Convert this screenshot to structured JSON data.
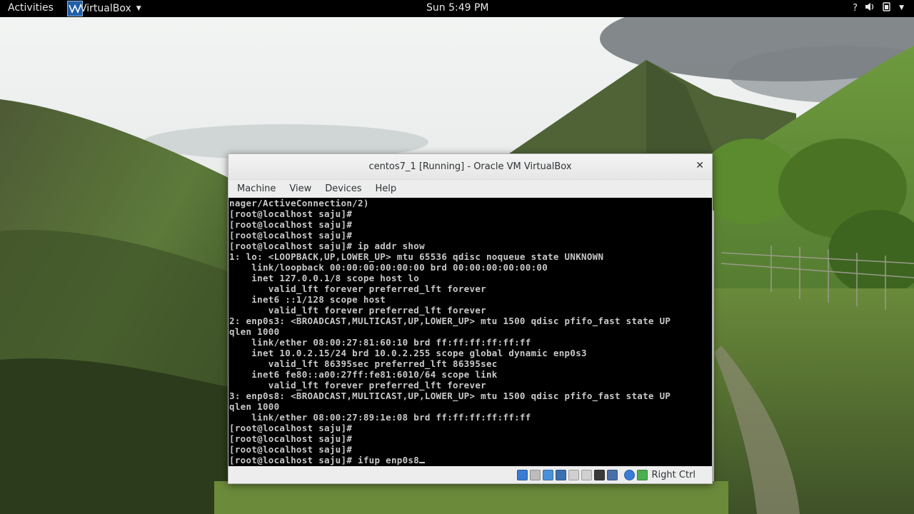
{
  "topbar": {
    "activities": "Activities",
    "app_name": "VirtualBox",
    "clock": "Sun  5:49 PM",
    "tray_help": "?"
  },
  "window": {
    "title": "centos7_1 [Running] - Oracle VM VirtualBox",
    "menu": [
      "Machine",
      "View",
      "Devices",
      "Help"
    ]
  },
  "console": {
    "lines": [
      "nager/ActiveConnection/2)",
      "[root@localhost saju]#",
      "[root@localhost saju]#",
      "[root@localhost saju]#",
      "[root@localhost saju]# ip addr show",
      "1: lo: <LOOPBACK,UP,LOWER_UP> mtu 65536 qdisc noqueue state UNKNOWN",
      "    link/loopback 00:00:00:00:00:00 brd 00:00:00:00:00:00",
      "    inet 127.0.0.1/8 scope host lo",
      "       valid_lft forever preferred_lft forever",
      "    inet6 ::1/128 scope host",
      "       valid_lft forever preferred_lft forever",
      "2: enp0s3: <BROADCAST,MULTICAST,UP,LOWER_UP> mtu 1500 qdisc pfifo_fast state UP",
      "qlen 1000",
      "    link/ether 08:00:27:81:60:10 brd ff:ff:ff:ff:ff:ff",
      "    inet 10.0.2.15/24 brd 10.0.2.255 scope global dynamic enp0s3",
      "       valid_lft 86395sec preferred_lft 86395sec",
      "    inet6 fe80::a00:27ff:fe81:6010/64 scope link",
      "       valid_lft forever preferred_lft forever",
      "3: enp0s8: <BROADCAST,MULTICAST,UP,LOWER_UP> mtu 1500 qdisc pfifo_fast state UP",
      "qlen 1000",
      "    link/ether 08:00:27:89:1e:08 brd ff:ff:ff:ff:ff:ff",
      "[root@localhost saju]#",
      "[root@localhost saju]#",
      "[root@localhost saju]#",
      "[root@localhost saju]# ifup enp0s8"
    ]
  },
  "statusbar": {
    "icons": [
      {
        "name": "hard-disk-icon",
        "color": "#3a7bd5"
      },
      {
        "name": "optical-drive-icon",
        "color": "#bdbdbd"
      },
      {
        "name": "audio-icon",
        "color": "#4a90d9"
      },
      {
        "name": "network-icon",
        "color": "#3a6fb0"
      },
      {
        "name": "usb-icon",
        "color": "#d0d0d0"
      },
      {
        "name": "shared-folders-icon",
        "color": "#d0d0d0"
      },
      {
        "name": "display-icon",
        "color": "#3a3a3a"
      },
      {
        "name": "video-capture-icon",
        "color": "#4a6fa8"
      },
      {
        "name": "mouse-integration-icon",
        "color": "#3a7bd5"
      },
      {
        "name": "keyboard-capture-icon",
        "color": "#4caf50"
      }
    ],
    "host_key": "Right Ctrl"
  }
}
